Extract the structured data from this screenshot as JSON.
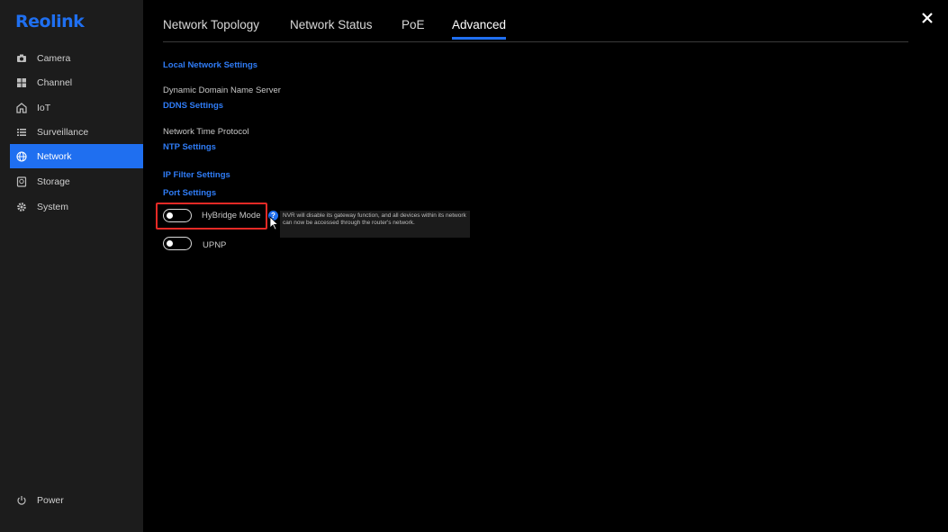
{
  "app": {
    "logo": "Reolink"
  },
  "sidebar": {
    "items": [
      {
        "label": "Camera",
        "icon": "camera-icon",
        "active": false
      },
      {
        "label": "Channel",
        "icon": "grid-icon",
        "active": false
      },
      {
        "label": "IoT",
        "icon": "home-icon",
        "active": false
      },
      {
        "label": "Surveillance",
        "icon": "list-icon",
        "active": false
      },
      {
        "label": "Network",
        "icon": "globe-icon",
        "active": true
      },
      {
        "label": "Storage",
        "icon": "storage-icon",
        "active": false
      },
      {
        "label": "System",
        "icon": "gear-icon",
        "active": false
      }
    ],
    "power_label": "Power"
  },
  "tabs": [
    {
      "label": "Network Topology",
      "active": false
    },
    {
      "label": "Network Status",
      "active": false
    },
    {
      "label": "PoE",
      "active": false
    },
    {
      "label": "Advanced",
      "active": true
    }
  ],
  "content": {
    "local_network_link": "Local Network Settings",
    "ddns_desc": "Dynamic Domain Name Server",
    "ddns_link": "DDNS Settings",
    "ntp_desc": "Network Time Protocol",
    "ntp_link": "NTP Settings",
    "ip_filter_link": "IP Filter Settings",
    "port_link": "Port Settings",
    "hybridge": {
      "label": "HyBridge Mode",
      "enabled": false
    },
    "upnp": {
      "label": "UPNP",
      "enabled": false
    },
    "tooltip": "NVR will disable its gateway function, and all devices within its network can now be accessed through the router's network."
  },
  "colors": {
    "accent": "#1f6ff0",
    "highlight": "#e52a26",
    "sidebar_bg": "#1c1c1c",
    "background": "#000000"
  }
}
